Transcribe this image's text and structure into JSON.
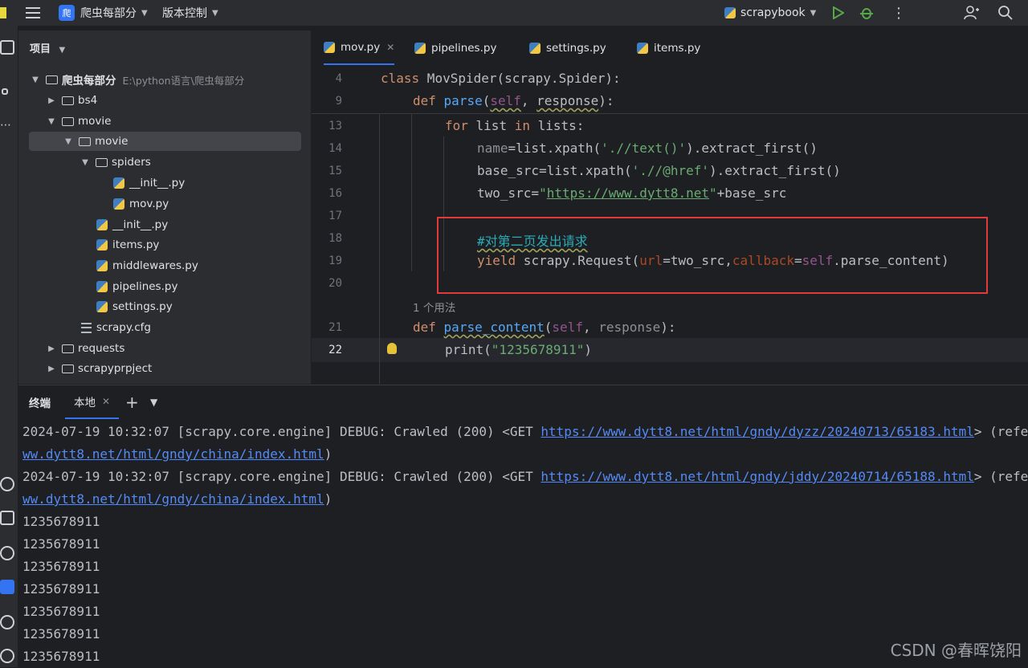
{
  "titlebar": {
    "project_badge": "爬",
    "project_name": "爬虫每部分",
    "vcs": "版本控制",
    "run_config": "scrapybook"
  },
  "project_panel": {
    "title": "项目",
    "root": {
      "name": "爬虫每部分",
      "path": "E:\\python语言\\爬虫每部分"
    },
    "items": [
      {
        "label": "bs4"
      },
      {
        "label": "movie"
      },
      {
        "label": "movie"
      },
      {
        "label": "spiders"
      },
      {
        "label": "__init__.py"
      },
      {
        "label": "mov.py"
      },
      {
        "label": "__init__.py"
      },
      {
        "label": "items.py"
      },
      {
        "label": "middlewares.py"
      },
      {
        "label": "pipelines.py"
      },
      {
        "label": "settings.py"
      },
      {
        "label": "scrapy.cfg"
      },
      {
        "label": "requests"
      },
      {
        "label": "scrapyprpject"
      }
    ]
  },
  "editor": {
    "tabs": [
      "mov.py",
      "pipelines.py",
      "settings.py",
      "items.py"
    ],
    "sticky": [
      {
        "num": "4",
        "code": "class MovSpider(scrapy.Spider):"
      },
      {
        "num": "9",
        "code": "def parse(self, response):"
      }
    ],
    "line_numbers": [
      "13",
      "14",
      "15",
      "16",
      "17",
      "18",
      "19",
      "20",
      "21",
      "22"
    ],
    "lines": {
      "l13_for": "for",
      "l13_a": " list ",
      "l13_in": "in",
      "l13_b": " lists:",
      "l14_a": "name",
      "l14_b": "=list.xpath(",
      "l14_str": "'.//text()'",
      "l14_c": ").extract_first()",
      "l15_a": "base_src=list.xpath(",
      "l15_str": "'.//@href'",
      "l15_c": ").extract_first()",
      "l16_a": "two_src=",
      "l16_q1": "\"",
      "l16_url": "https://www.dytt8.net",
      "l16_q2": "\"",
      "l16_b": "+base_src",
      "l18_comment": "#对第二页发出请求",
      "l19_yield": "yield",
      "l19_a": " scrapy.Request(",
      "l19_url": "url",
      "l19_b": "=two_src,",
      "l19_cb": "callback",
      "l19_c": "=",
      "l19_self": "self",
      "l19_d": ".parse_content)",
      "l21_def": "def",
      "l21_fn": "parse_content",
      "l21_p1": "(",
      "l21_self": "self",
      "l21_p2": ", ",
      "l21_resp": "response",
      "l21_p3": "):",
      "l22_a": "print(",
      "l22_str": "\"1235678911\"",
      "l22_b": ")"
    },
    "usage_hint": "1 个用法"
  },
  "terminal": {
    "title": "终端",
    "tab": "本地",
    "log1": {
      "prefix": "2024-07-19 10:32:07 [scrapy.core.engine] DEBUG: Crawled (200) <GET ",
      "url": "https://www.dytt8.net/html/gndy/dyzz/20240713/65183.html",
      "suffix": "> (refe",
      "cont": "ww.dytt8.net/html/gndy/china/index.html",
      "cont_suffix": ")"
    },
    "log2": {
      "prefix": "2024-07-19 10:32:07 [scrapy.core.engine] DEBUG: Crawled (200) <GET ",
      "url": "https://www.dytt8.net/html/gndy/jddy/20240714/65188.html",
      "suffix": "> (refe",
      "cont": "ww.dytt8.net/html/gndy/china/index.html",
      "cont_suffix": ")"
    },
    "output": [
      "1235678911",
      "1235678911",
      "1235678911",
      "1235678911",
      "1235678911",
      "1235678911",
      "1235678911"
    ]
  },
  "watermark": "CSDN @春晖饶阳",
  "colors": {
    "accent": "#3574f0",
    "highlight_box": "#e0393e",
    "link": "#548af7"
  }
}
